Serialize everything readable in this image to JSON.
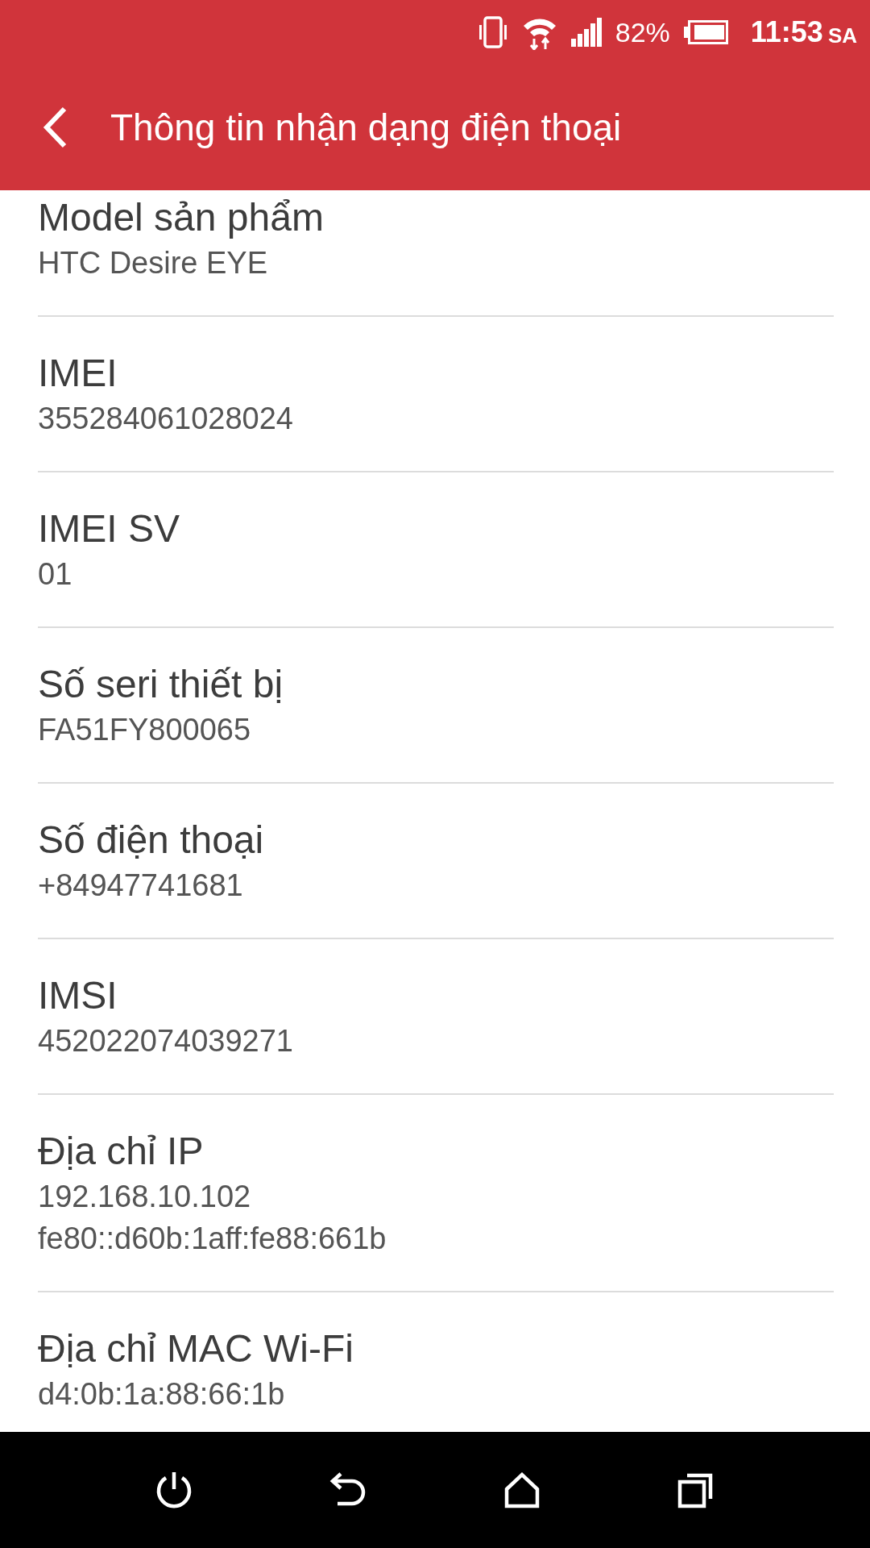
{
  "status_bar": {
    "battery": "82%",
    "time": "11:53",
    "meridiem": "SA"
  },
  "app_bar": {
    "title": "Thông tin nhận dạng điện thoại"
  },
  "items": [
    {
      "label": "Model sản phẩm",
      "values": [
        "HTC Desire EYE"
      ]
    },
    {
      "label": "IMEI",
      "values": [
        "355284061028024"
      ]
    },
    {
      "label": "IMEI SV",
      "values": [
        "01"
      ]
    },
    {
      "label": "Số seri thiết bị",
      "values": [
        "FA51FY800065"
      ]
    },
    {
      "label": "Số điện thoại",
      "values": [
        "+84947741681"
      ]
    },
    {
      "label": "IMSI",
      "values": [
        "452022074039271"
      ]
    },
    {
      "label": "Địa chỉ IP",
      "values": [
        "192.168.10.102",
        "fe80::d60b:1aff:fe88:661b"
      ]
    },
    {
      "label": "Địa chỉ MAC Wi-Fi",
      "values": [
        "d4:0b:1a:88:66:1b"
      ]
    }
  ]
}
